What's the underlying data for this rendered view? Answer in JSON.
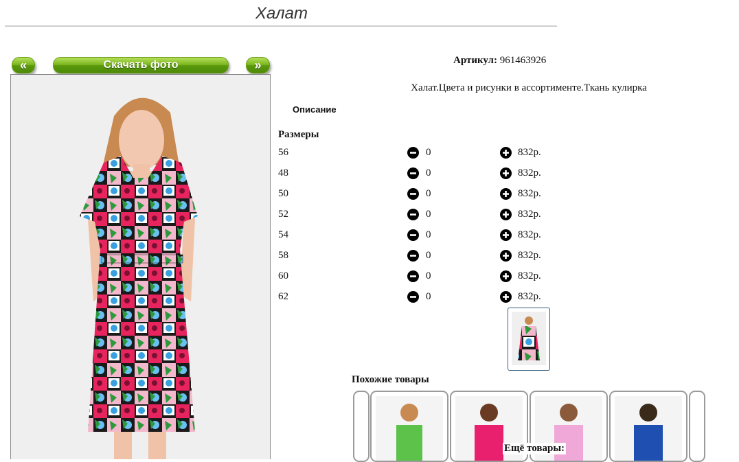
{
  "page": {
    "title": "Халат"
  },
  "gallery": {
    "prev_label": "«",
    "download_label": "Скачать фото",
    "next_label": "»"
  },
  "product": {
    "article_label": "Артикул:",
    "article_value": "961463926",
    "description_text": "Халат.Цвета и рисунки в ассортименте.Ткань кулирка",
    "description_heading": "Описание",
    "sizes_heading": "Размеры"
  },
  "sizes": [
    {
      "size": "56",
      "qty": "0",
      "price": "832р."
    },
    {
      "size": "48",
      "qty": "0",
      "price": "832р."
    },
    {
      "size": "50",
      "qty": "0",
      "price": "832р."
    },
    {
      "size": "52",
      "qty": "0",
      "price": "832р."
    },
    {
      "size": "54",
      "qty": "0",
      "price": "832р."
    },
    {
      "size": "58",
      "qty": "0",
      "price": "832р."
    },
    {
      "size": "60",
      "qty": "0",
      "price": "832р."
    },
    {
      "size": "62",
      "qty": "0",
      "price": "832р."
    }
  ],
  "similar": {
    "heading": "Похожие товары",
    "items": [
      {
        "color": "#5cc24a"
      },
      {
        "color": "#e8206e"
      },
      {
        "color": "#f0a8d8"
      },
      {
        "color": "#1f4fb0"
      }
    ]
  },
  "more_label": "Ещё товары:",
  "colors": {
    "accent_green": "#6aaa14",
    "thumb_border": "#355a7a"
  }
}
